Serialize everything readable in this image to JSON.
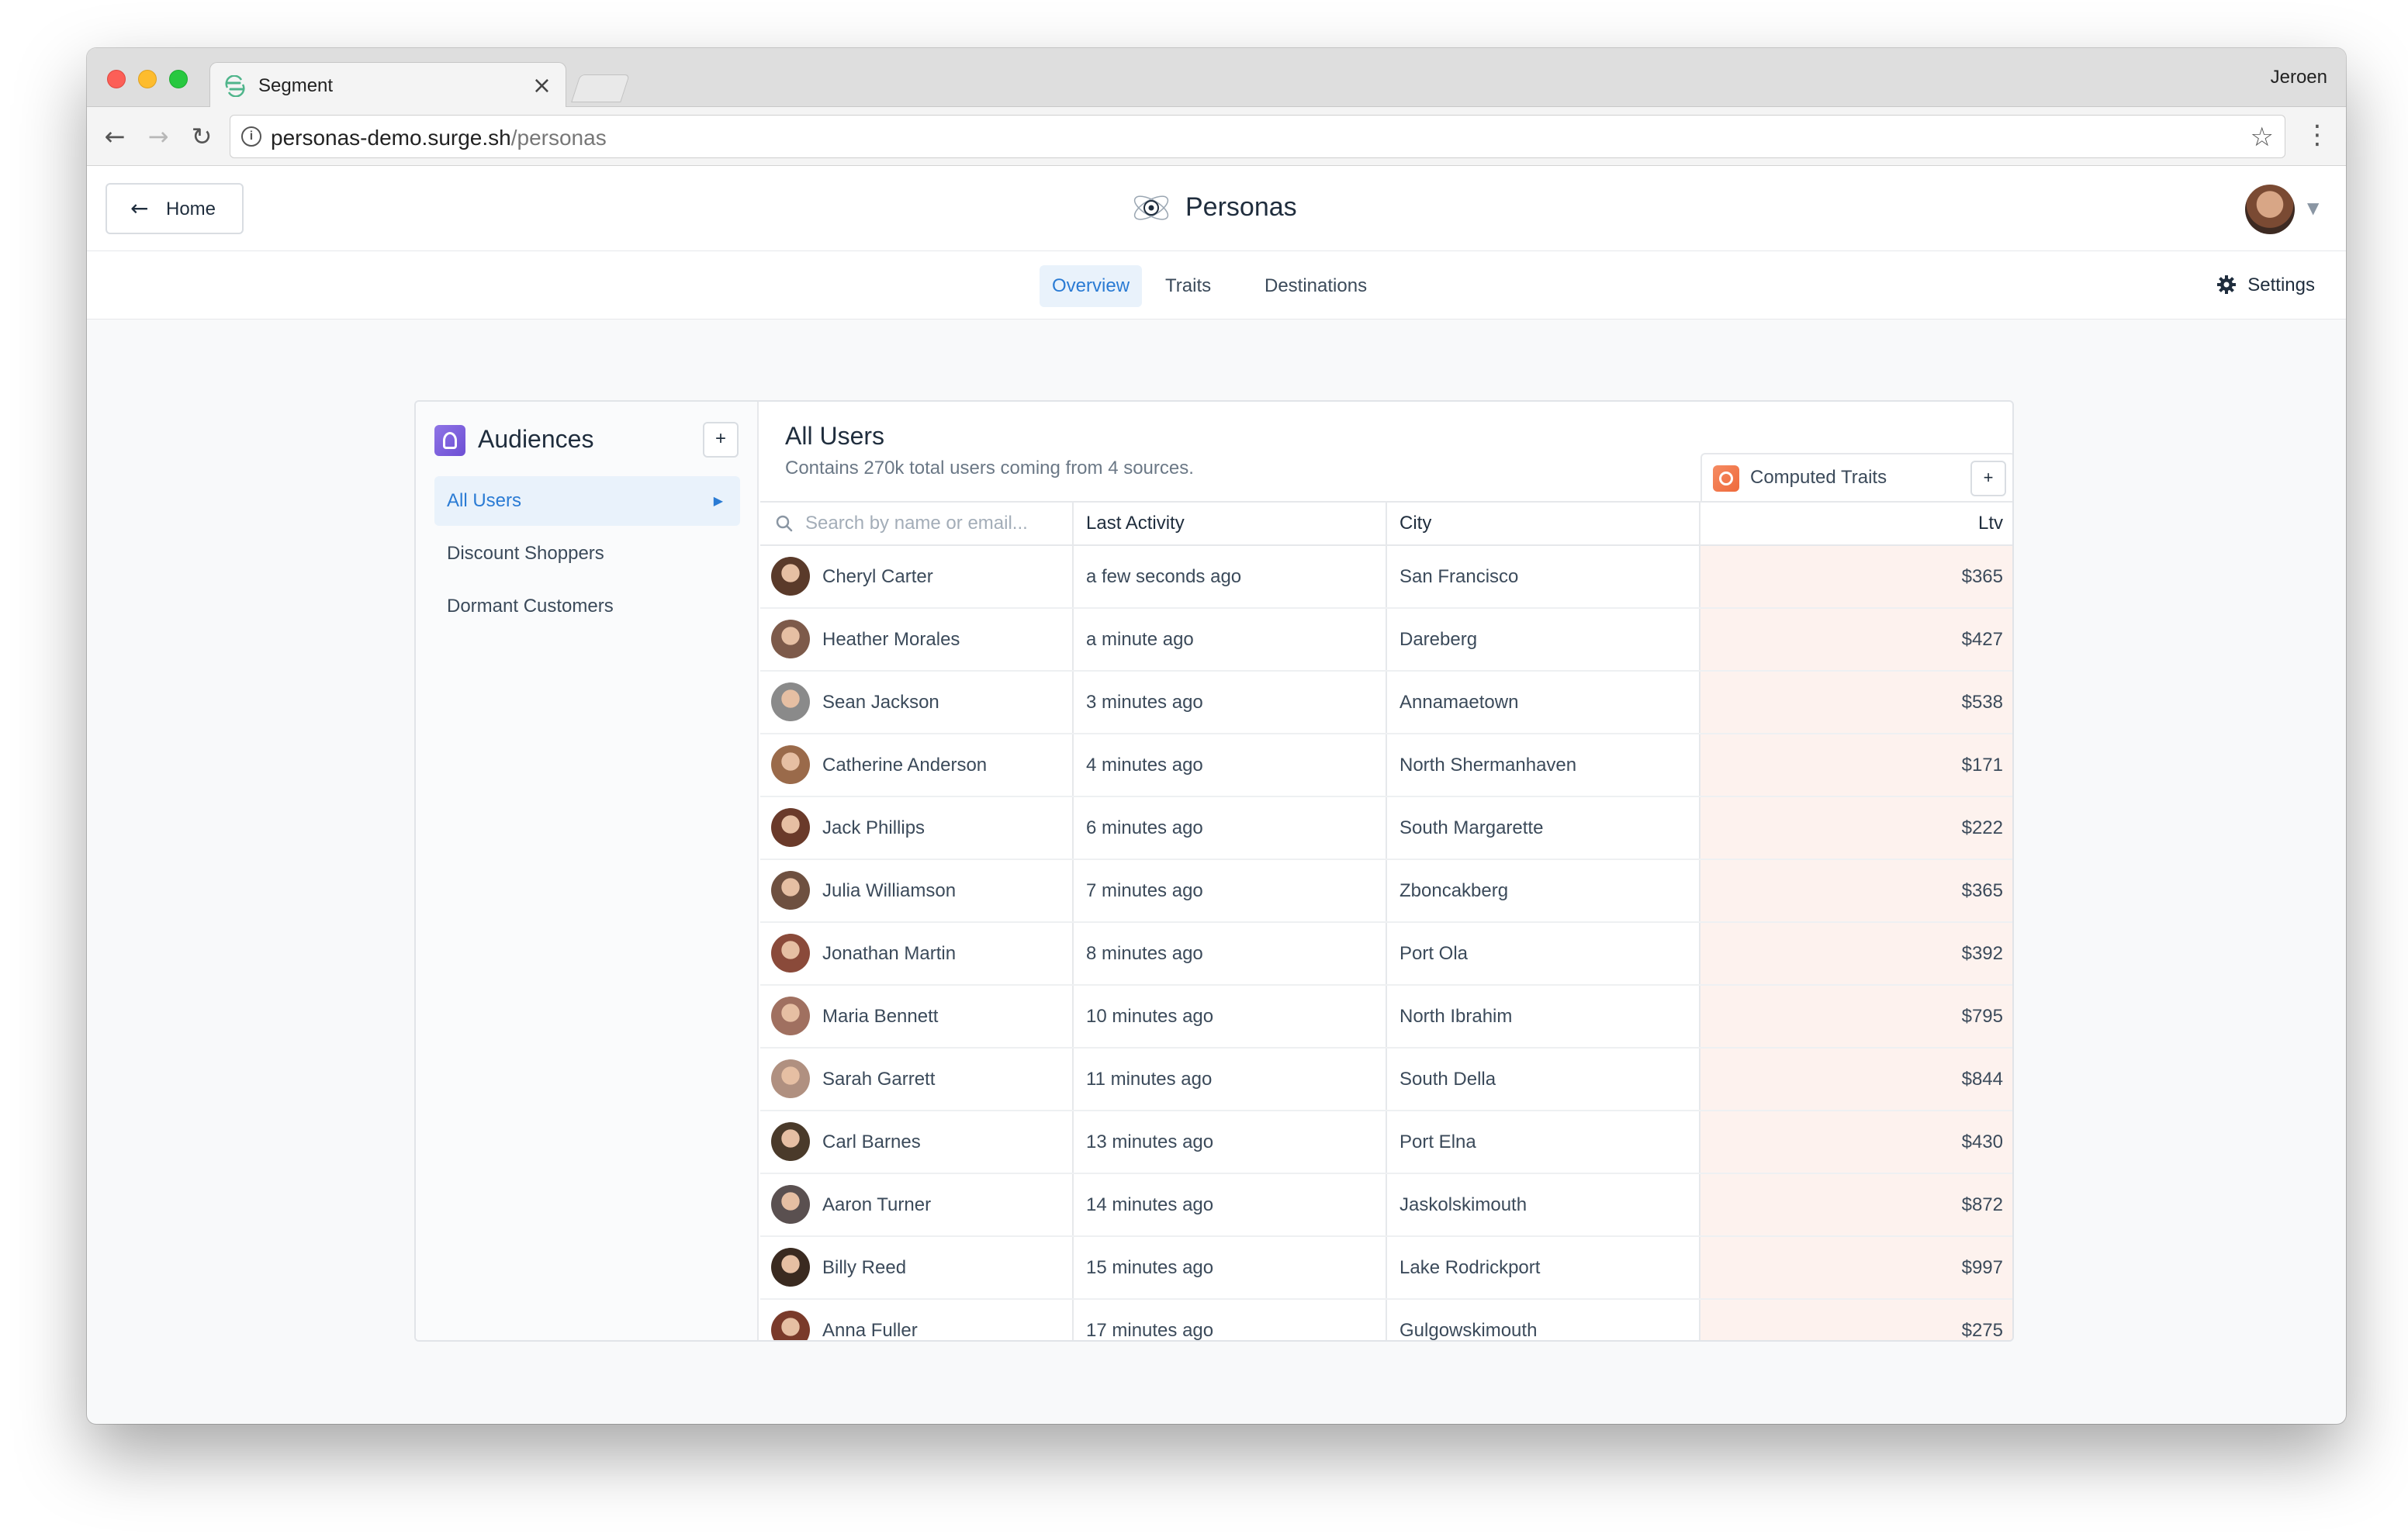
{
  "browser": {
    "tab_title": "Segment",
    "tab_close": "×",
    "profile_name": "Jeroen",
    "url_host": "personas-demo.surge.sh",
    "url_path": "/personas"
  },
  "header": {
    "home_label": "Home",
    "brand_name": "Personas"
  },
  "subnav": {
    "tabs": [
      {
        "label": "Overview",
        "active": true
      },
      {
        "label": "Traits",
        "active": false
      },
      {
        "label": "Destinations",
        "active": false
      }
    ],
    "settings_label": "Settings"
  },
  "sidebar": {
    "title": "Audiences",
    "add_label": "+",
    "items": [
      {
        "label": "All Users",
        "active": true
      },
      {
        "label": "Discount Shoppers",
        "active": false
      },
      {
        "label": "Dormant Customers",
        "active": false
      }
    ]
  },
  "main": {
    "title": "All Users",
    "description": "Contains 270k total users coming from 4 sources.",
    "computed_traits_label": "Computed Traits",
    "computed_traits_add": "+",
    "table": {
      "search_placeholder": "Search by name or email...",
      "columns": [
        "Last Activity",
        "City",
        "Ltv"
      ],
      "rows": [
        {
          "name": "Cheryl Carter",
          "activity": "a few seconds ago",
          "city": "San Francisco",
          "ltv": "$365",
          "avatar_color": "#5a3a2a"
        },
        {
          "name": "Heather Morales",
          "activity": "a minute ago",
          "city": "Dareberg",
          "ltv": "$427",
          "avatar_color": "#7d5a4a"
        },
        {
          "name": "Sean Jackson",
          "activity": "3 minutes ago",
          "city": "Annamaetown",
          "ltv": "$538",
          "avatar_color": "#8a8a8a"
        },
        {
          "name": "Catherine Anderson",
          "activity": "4 minutes ago",
          "city": "North Shermanhaven",
          "ltv": "$171",
          "avatar_color": "#9a6a4a"
        },
        {
          "name": "Jack Phillips",
          "activity": "6 minutes ago",
          "city": "South Margarette",
          "ltv": "$222",
          "avatar_color": "#6a3a2a"
        },
        {
          "name": "Julia Williamson",
          "activity": "7 minutes ago",
          "city": "Zboncakberg",
          "ltv": "$365",
          "avatar_color": "#6e5040"
        },
        {
          "name": "Jonathan Martin",
          "activity": "8 minutes ago",
          "city": "Port Ola",
          "ltv": "$392",
          "avatar_color": "#8a4a3a"
        },
        {
          "name": "Maria Bennett",
          "activity": "10 minutes ago",
          "city": "North Ibrahim",
          "ltv": "$795",
          "avatar_color": "#a07060"
        },
        {
          "name": "Sarah Garrett",
          "activity": "11 minutes ago",
          "city": "South Della",
          "ltv": "$844",
          "avatar_color": "#b09080"
        },
        {
          "name": "Carl Barnes",
          "activity": "13 minutes ago",
          "city": "Port Elna",
          "ltv": "$430",
          "avatar_color": "#4a3a2a"
        },
        {
          "name": "Aaron Turner",
          "activity": "14 minutes ago",
          "city": "Jaskolskimouth",
          "ltv": "$872",
          "avatar_color": "#5a5050"
        },
        {
          "name": "Billy Reed",
          "activity": "15 minutes ago",
          "city": "Lake Rodrickport",
          "ltv": "$997",
          "avatar_color": "#3a2a20"
        },
        {
          "name": "Anna Fuller",
          "activity": "17 minutes ago",
          "city": "Gulgowskimouth",
          "ltv": "$275",
          "avatar_color": "#7a3a2a"
        }
      ]
    }
  },
  "colors": {
    "accent": "#2a7bd4",
    "active_bg": "#e9f2fb",
    "computed_col_bg": "#fdf2ee",
    "audiences_icon": "#7c5fdc",
    "computed_traits_icon": "#f07a4a"
  },
  "icons": [
    "segment-logo-icon",
    "close-icon",
    "info-icon",
    "star-icon",
    "more-vert-icon",
    "back-arrow-icon",
    "forward-arrow-icon",
    "reload-icon",
    "personas-logo-icon",
    "chevron-down-icon",
    "gear-icon",
    "audiences-icon",
    "chevron-right-icon",
    "computed-traits-icon",
    "search-icon"
  ]
}
